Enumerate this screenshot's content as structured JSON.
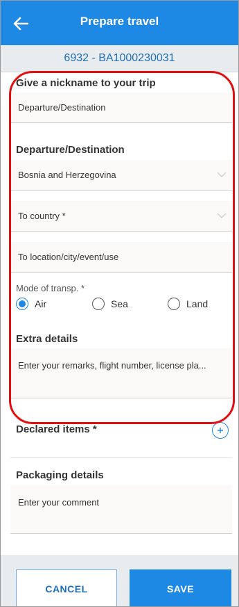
{
  "header": {
    "title": "Prepare travel"
  },
  "subheader": {
    "text": "6932 - BA1000230031"
  },
  "form": {
    "nickname_label": "Give a nickname to your trip",
    "nickname_value": "Departure/Destination",
    "departure_label": "Departure/Destination",
    "from_country": "Bosnia and Herzegovina",
    "to_country_placeholder": "To country *",
    "to_location_placeholder": "To location/city/event/use",
    "mode_label": "Mode of transp. *",
    "modes": [
      {
        "label": "Air",
        "selected": true
      },
      {
        "label": "Sea",
        "selected": false
      },
      {
        "label": "Land",
        "selected": false
      }
    ],
    "extra_label": "Extra details",
    "extra_placeholder": "Enter your remarks, flight number, license pla...",
    "declared_label": "Declared items *",
    "packaging_label": "Packaging details",
    "packaging_placeholder": "Enter your comment"
  },
  "footer": {
    "cancel_label": "CANCEL",
    "save_label": "SAVE"
  },
  "colors": {
    "primary": "#1e88e5",
    "highlight": "#e01010"
  },
  "icons": {
    "back": "arrow-left-icon",
    "dropdown": "chevron-down-icon",
    "add": "plus-icon"
  }
}
